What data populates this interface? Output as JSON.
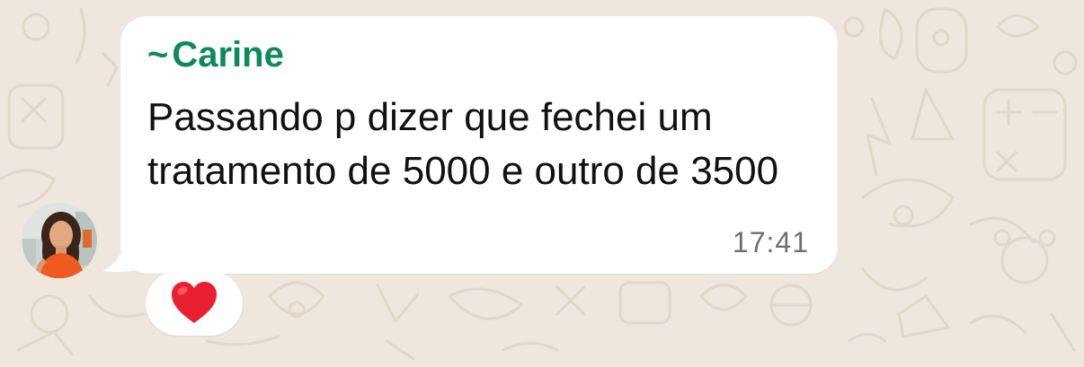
{
  "chat": {
    "message": {
      "sender_prefix": "~",
      "sender_name": "Carine",
      "text": "Passando p dizer que fechei um tratamento de 5000 e outro de 3500",
      "time": "17:41",
      "avatar_icon": "contact-photo-avatar",
      "reaction": {
        "emoji_icon": "red-heart-emoji",
        "color": "#e8202f"
      }
    }
  },
  "colors": {
    "wallpaper": "#efe7dd",
    "bubble": "#ffffff",
    "sender_name": "#0d8a5a",
    "timestamp": "#6f6f6f"
  }
}
